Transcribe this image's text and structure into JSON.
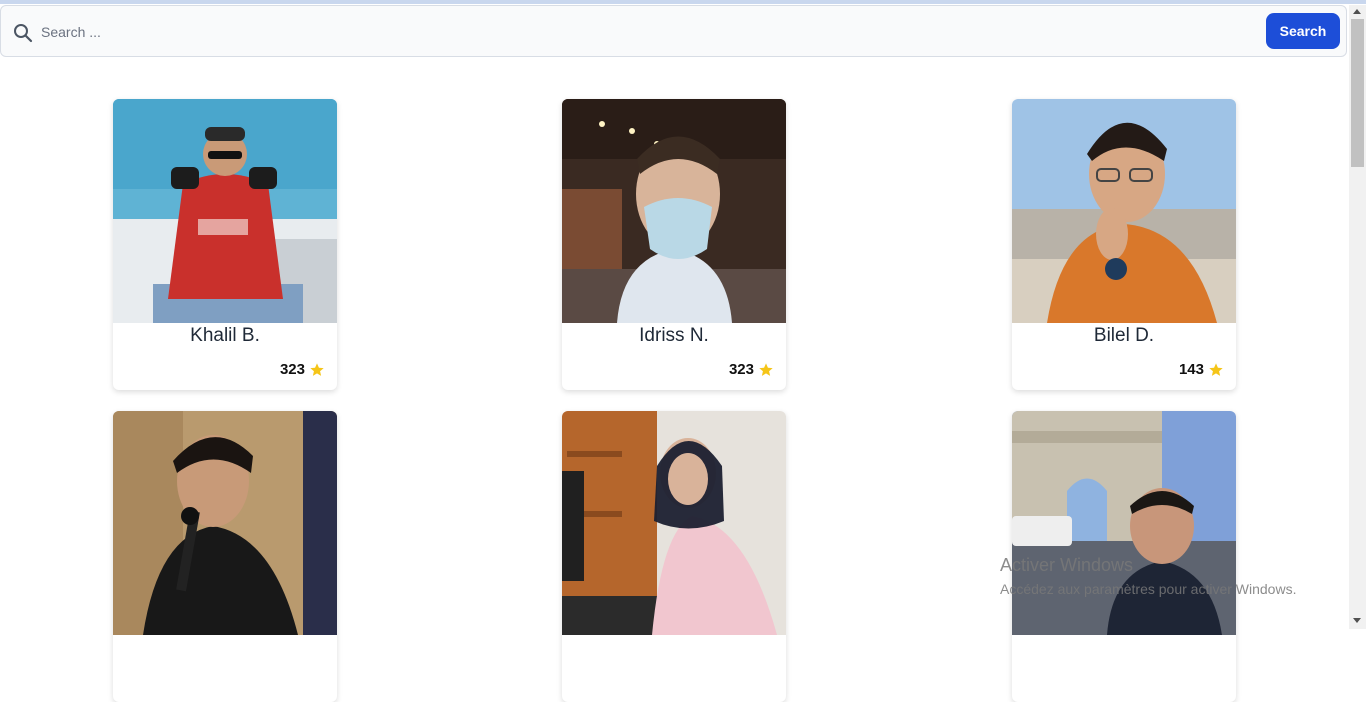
{
  "search": {
    "placeholder": "Search ...",
    "button_label": "Search"
  },
  "colors": {
    "accent": "#1d4ed8",
    "star": "#f5c518"
  },
  "profiles": [
    {
      "name": "Khalil B.",
      "rating": "323"
    },
    {
      "name": "Idriss N.",
      "rating": "323"
    },
    {
      "name": "Bilel D.",
      "rating": "143"
    },
    {
      "name": "",
      "rating": ""
    },
    {
      "name": "",
      "rating": ""
    },
    {
      "name": "",
      "rating": ""
    }
  ],
  "watermark": {
    "title": "Activer Windows",
    "subtitle": "Accédez aux paramètres pour activer Windows."
  }
}
